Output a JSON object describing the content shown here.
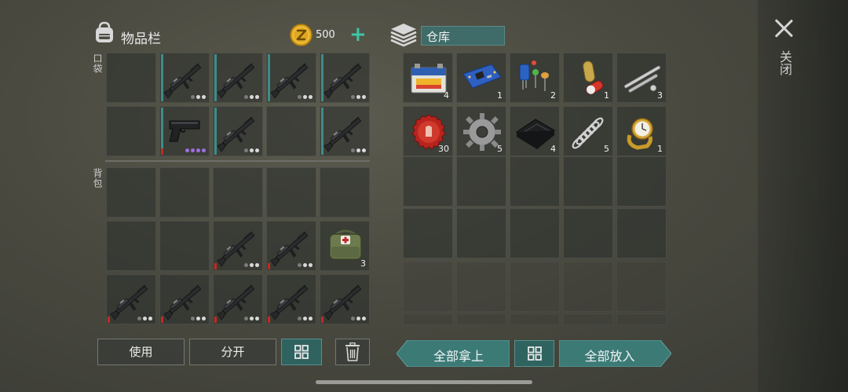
{
  "inventory": {
    "title": "物品栏",
    "coins": "500",
    "pocket_label": "口袋",
    "backpack_label": "背包",
    "pocket_slots": [
      {
        "item": "",
        "count": ""
      },
      {
        "item": "rifle-icon",
        "count": "",
        "dots": [
          false,
          true,
          true
        ]
      },
      {
        "item": "rifle-icon",
        "count": "",
        "dots": [
          false,
          true,
          true
        ]
      },
      {
        "item": "rifle-icon",
        "count": "",
        "dots": [
          false,
          true,
          true
        ]
      },
      {
        "item": "rifle-icon",
        "count": "",
        "dots": [
          false,
          true,
          true
        ]
      },
      {
        "item": "",
        "count": ""
      },
      {
        "item": "pistol-icon",
        "count": "",
        "dots": [
          true,
          true,
          true,
          true
        ]
      },
      {
        "item": "rifle-icon",
        "count": "",
        "dots": [
          false,
          true,
          true
        ]
      },
      {
        "item": "",
        "count": ""
      },
      {
        "item": "rifle-icon",
        "count": "",
        "dots": [
          false,
          true,
          true
        ]
      }
    ],
    "backpack_slots": [
      {
        "item": "",
        "count": ""
      },
      {
        "item": "",
        "count": ""
      },
      {
        "item": "",
        "count": ""
      },
      {
        "item": "",
        "count": ""
      },
      {
        "item": "",
        "count": ""
      },
      {
        "item": "",
        "count": ""
      },
      {
        "item": "",
        "count": ""
      },
      {
        "item": "rifle-icon",
        "count": "",
        "dots": [
          false,
          true,
          true
        ]
      },
      {
        "item": "rifle-icon",
        "count": "",
        "dots": [
          false,
          true,
          true
        ]
      },
      {
        "item": "medkit-icon",
        "count": "3"
      },
      {
        "item": "rifle-icon",
        "count": "",
        "dots": [
          false,
          true,
          true
        ]
      },
      {
        "item": "rifle-icon",
        "count": "",
        "dots": [
          false,
          true,
          true
        ]
      },
      {
        "item": "rifle-icon",
        "count": "",
        "dots": [
          false,
          true,
          true
        ]
      },
      {
        "item": "rifle-icon",
        "count": "",
        "dots": [
          false,
          true,
          true
        ]
      },
      {
        "item": "rifle-icon",
        "count": "",
        "dots": [
          false,
          true,
          true
        ]
      }
    ],
    "buttons": {
      "use": "使用",
      "split": "分开"
    }
  },
  "warehouse": {
    "title": "仓库",
    "slots": [
      {
        "item": "battery-icon",
        "count": "4"
      },
      {
        "item": "circuit-board-icon",
        "count": "1"
      },
      {
        "item": "electronic-components-icon",
        "count": "2"
      },
      {
        "item": "pill-capsule-icon",
        "count": "1"
      },
      {
        "item": "tools-icon",
        "count": "3"
      },
      {
        "item": "bottle-cap-icon",
        "count": "30"
      },
      {
        "item": "gear-icon",
        "count": "5"
      },
      {
        "item": "cloth-icon",
        "count": "4"
      },
      {
        "item": "spring-icon",
        "count": "5"
      },
      {
        "item": "watch-icon",
        "count": "1"
      }
    ],
    "buttons": {
      "take_all": "全部拿上",
      "put_all": "全部放入"
    }
  },
  "close_label": "关闭",
  "colors": {
    "teal": "#3c7a76",
    "accent": "#3b8d8a",
    "coin": "#e0a820",
    "plus": "#3fc6a6"
  }
}
